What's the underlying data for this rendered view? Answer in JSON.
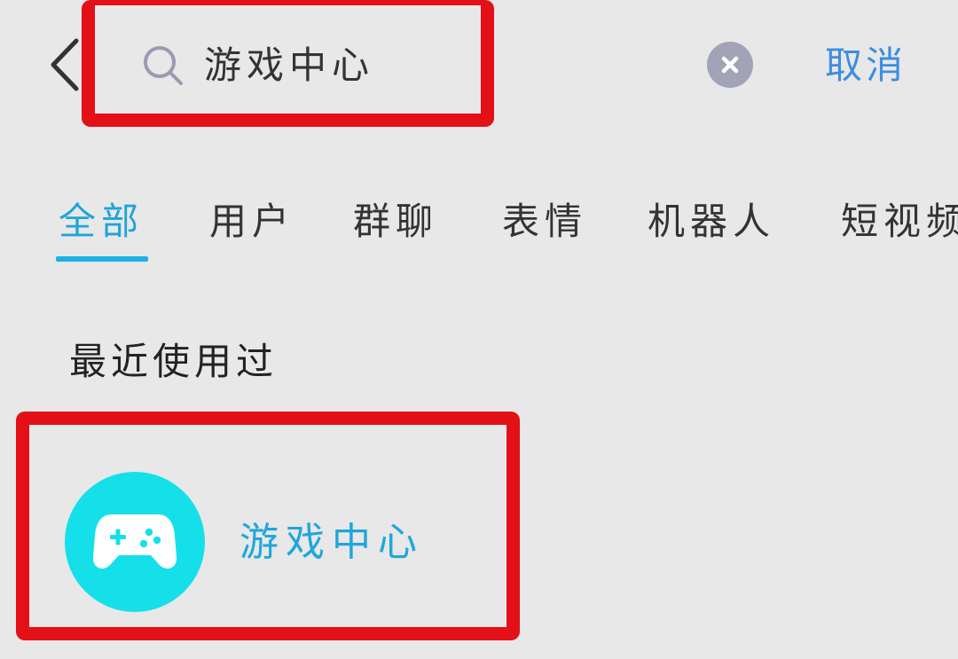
{
  "search": {
    "query": "游戏中心",
    "cancel_label": "取消"
  },
  "tabs": [
    {
      "label": "全部",
      "active": true
    },
    {
      "label": "用户",
      "active": false
    },
    {
      "label": "群聊",
      "active": false
    },
    {
      "label": "表情",
      "active": false
    },
    {
      "label": "机器人",
      "active": false
    },
    {
      "label": "短视频",
      "active": false
    }
  ],
  "recent": {
    "section_title": "最近使用过",
    "items": [
      {
        "name": "游戏中心",
        "icon": "gamepad-icon"
      }
    ]
  },
  "colors": {
    "accent": "#1cb2e5",
    "highlight_frame": "#e31018",
    "app_icon_bg": "#15e0ea",
    "cancel_text": "#3b8ee0"
  }
}
